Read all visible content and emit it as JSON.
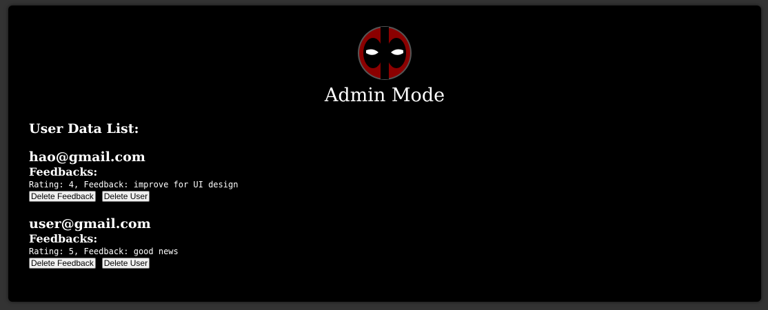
{
  "header": {
    "title": "Admin Mode"
  },
  "logo": {
    "icon": "deadpool-mask-icon",
    "colors": {
      "mask": "#8b0000",
      "eye_patch": "#000000",
      "eye": "#ffffff",
      "ring": "#555555"
    }
  },
  "list": {
    "heading": "User Data List:",
    "users": [
      {
        "email": "hao@gmail.com",
        "feedbacks_label": "Feedbacks:",
        "feedback": "Rating: 4, Feedback: improve for UI design",
        "delete_feedback_label": "Delete Feedback",
        "delete_user_label": "Delete User"
      },
      {
        "email": "user@gmail.com",
        "feedbacks_label": "Feedbacks:",
        "feedback": "Rating: 5, Feedback: good news",
        "delete_feedback_label": "Delete Feedback",
        "delete_user_label": "Delete User"
      }
    ]
  }
}
